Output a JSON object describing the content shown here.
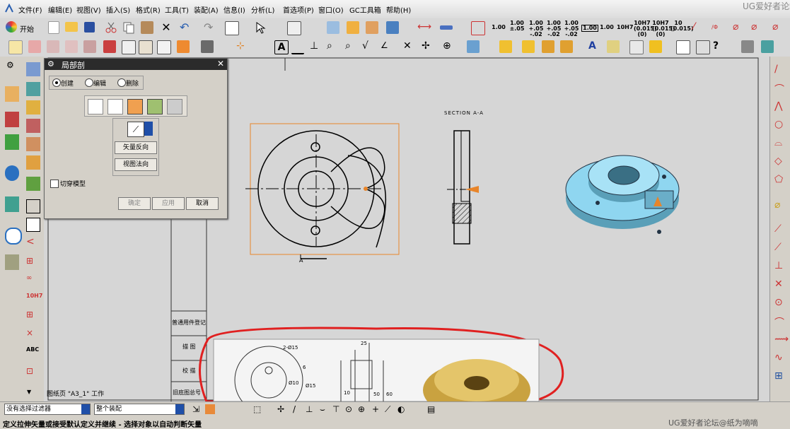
{
  "menubar": {
    "items": [
      "文件(F)",
      "编辑(E)",
      "视图(V)",
      "插入(S)",
      "格式(R)",
      "工具(T)",
      "装配(A)",
      "信息(I)",
      "分析(L)",
      "首选项(P)",
      "窗口(O)",
      "GC工具箱",
      "帮助(H)"
    ],
    "watermark_top": "UG爱好者论坛"
  },
  "toolbar": {
    "start_label": "开始",
    "tolerances": [
      "1.00",
      "1.00 ±.05",
      "1.00 +.05 -.02",
      "1.00 +.05 -.02",
      "1.00 +.05 -.02",
      "1.00",
      "1.00",
      "10H7",
      "10H7 (0.015) (0)",
      "10H7 (0.015) (0)",
      "10 (0.015)"
    ]
  },
  "dialog": {
    "title": "局部剖",
    "radio_create": "创建",
    "radio_edit": "编辑",
    "radio_delete": "删除",
    "btn_reverse_vector": "矢量反向",
    "btn_view_normal": "视图法向",
    "checkbox_cut_model": "切穿模型",
    "btn_ok": "确定",
    "btn_apply": "应用",
    "btn_cancel": "取消"
  },
  "drawing": {
    "section_label": "SECTION A-A",
    "view_label_a": "A",
    "sheet_label": "图纸页 \"A3_1\" 工作",
    "title_block": [
      "普通用件登记",
      "描 图",
      "校 描",
      "旧底图总号"
    ],
    "scan_dims": [
      "2-Ø15",
      "25",
      "6",
      "Ø10",
      "Ø15",
      "10",
      "50",
      "60"
    ]
  },
  "status": {
    "filter_value": "没有选择过滤器",
    "assembly_value": "整个装配",
    "prompt": "定义拉伸矢量或接受默认定义并继续 - 选择对象以自动判断矢量",
    "watermark_bottom": "UG爱好者论坛@纸为嘀嘀"
  },
  "colors": {
    "accent_orange": "#e8852a",
    "model_cyan": "#8fd6f0",
    "annotation_red": "#e02020"
  }
}
